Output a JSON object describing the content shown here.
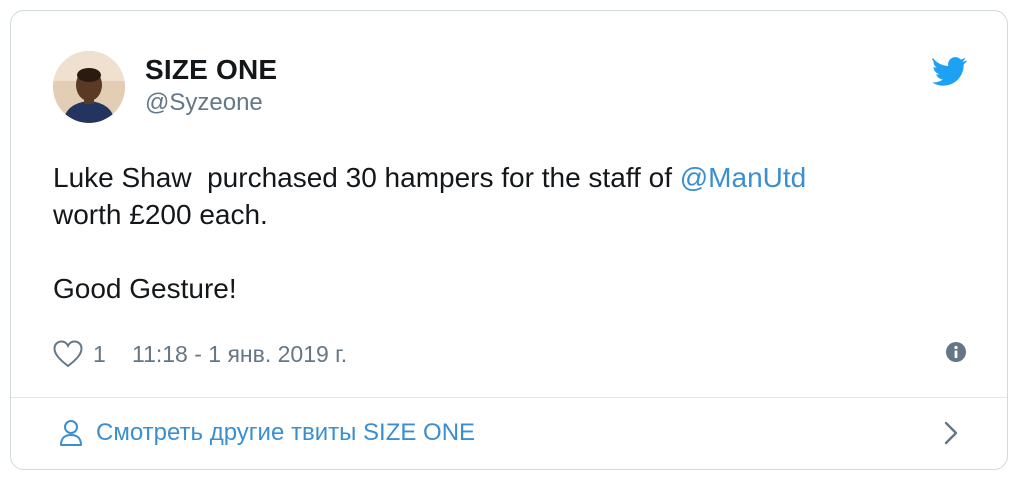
{
  "author": {
    "display_name": "SIZE ONE",
    "handle": "@Syzeone"
  },
  "tweet": {
    "text_before_mention": "Luke Shaw  purchased 30 hampers for the staff of ",
    "mention": "@ManUtd",
    "text_after_mention": "\nworth £200 each.\n\nGood Gesture!"
  },
  "meta": {
    "like_count": "1",
    "timestamp": "11:18 - 1 янв. 2019 г."
  },
  "footer": {
    "link_label": "Смотреть другие твиты SIZE ONE"
  },
  "icons": {
    "brand": "twitter-bird-icon",
    "like": "heart-icon",
    "info": "info-icon",
    "profile": "person-icon",
    "next": "chevron-right-icon"
  },
  "colors": {
    "text": "#14171a",
    "secondary_text": "#657786",
    "link": "#3b8fd0",
    "twitter_blue": "#1da1f2",
    "border": "#cfd9de"
  }
}
